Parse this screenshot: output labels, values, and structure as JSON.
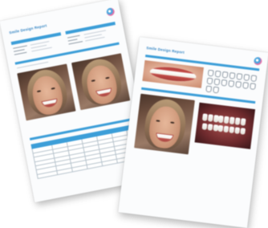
{
  "colors": {
    "accent": "#3c9ed8",
    "title": "#2a7fc0",
    "paper": "#fbfcfd"
  },
  "icons": [
    "logo-icon"
  ],
  "documents": [
    {
      "title": "Smile Design Report",
      "website": "",
      "footer": "",
      "sections": [
        "photo-comparison",
        "measurement-table"
      ]
    },
    {
      "title": "Smile Design Report",
      "website": "",
      "footer": "",
      "sections": [
        "lips-photo",
        "tooth-diagram",
        "portrait-photo",
        "intraoral-photo"
      ]
    }
  ]
}
